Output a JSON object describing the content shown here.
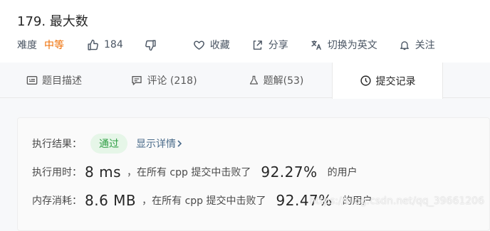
{
  "problem": {
    "title": "179. 最大数",
    "difficulty_label": "难度",
    "difficulty_value": "中等",
    "likes": "184",
    "favorite_label": "收藏",
    "share_label": "分享",
    "lang_switch_label": "切换为英文",
    "follow_label": "关注"
  },
  "tabs": [
    {
      "label": "题目描述",
      "icon": "description-icon"
    },
    {
      "label": "评论 (218)",
      "icon": "comment-icon"
    },
    {
      "label": "题解(53)",
      "icon": "flask-icon"
    },
    {
      "label": "提交记录",
      "icon": "clock-icon",
      "active": true
    }
  ],
  "result": {
    "status_label": "执行结果：",
    "status_value": "通过",
    "detail_label": "显示详情",
    "time_label": "执行用时：",
    "time_value": "8 ms",
    "time_mid": "，在所有 cpp 提交中击败了",
    "time_pct": "92.27%",
    "time_suffix": "的用户",
    "mem_label": "内存消耗：",
    "mem_value": "8.6 MB",
    "mem_mid": "，在所有 cpp 提交中击败了",
    "mem_pct": "92.47%",
    "mem_suffix": "的用户"
  },
  "watermark": "https://blog.csdn.net/qq_39661206",
  "colors": {
    "accepted_bg": "#e6f6e8",
    "accepted_text": "#2f9e44",
    "medium": "#ef6c00"
  }
}
